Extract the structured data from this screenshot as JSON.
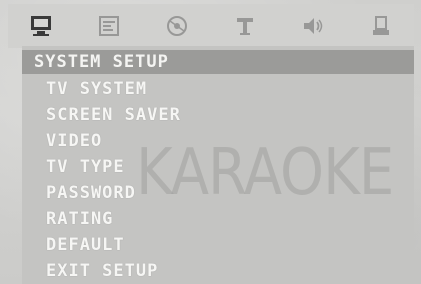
{
  "icons": [
    "monitor-icon",
    "settings-panel-icon",
    "disc-icon",
    "speaker-brand-icon",
    "audio-speaker-icon",
    "preference-icon"
  ],
  "menu": {
    "title": "SYSTEM SETUP",
    "items": [
      {
        "label": "TV SYSTEM"
      },
      {
        "label": "SCREEN SAVER"
      },
      {
        "label": "VIDEO"
      },
      {
        "label": "TV TYPE"
      },
      {
        "label": "PASSWORD"
      },
      {
        "label": "RATING"
      },
      {
        "label": "DEFAULT"
      },
      {
        "label": "EXIT SETUP"
      }
    ]
  },
  "watermark": "KARAOKE",
  "colors": {
    "background": "#d6d6d4",
    "title_bar": "#9b9b99",
    "text": "#f4f4f2"
  }
}
